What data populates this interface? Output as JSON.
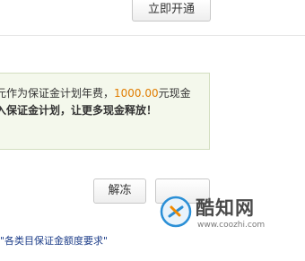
{
  "top": {
    "open_button_label": "立即开通"
  },
  "notice": {
    "line1_prefix": "元作为保证金计划年费，",
    "amount": "1000.00",
    "line1_suffix": "元现金",
    "line2": "入保证金计划，让更多现金释放！"
  },
  "actions": {
    "unfreeze_label": "解冻",
    "second_label": ""
  },
  "footer": {
    "requirements_link": "\"各类目保证金额度要求\""
  },
  "watermark": {
    "site_name": "酷知网",
    "url": "www.coozhi.com"
  },
  "colors": {
    "amount": "#e07c00",
    "notice_bg": "#f4f8ec",
    "notice_border": "#d3dfc0",
    "link": "#1f3f8a"
  }
}
